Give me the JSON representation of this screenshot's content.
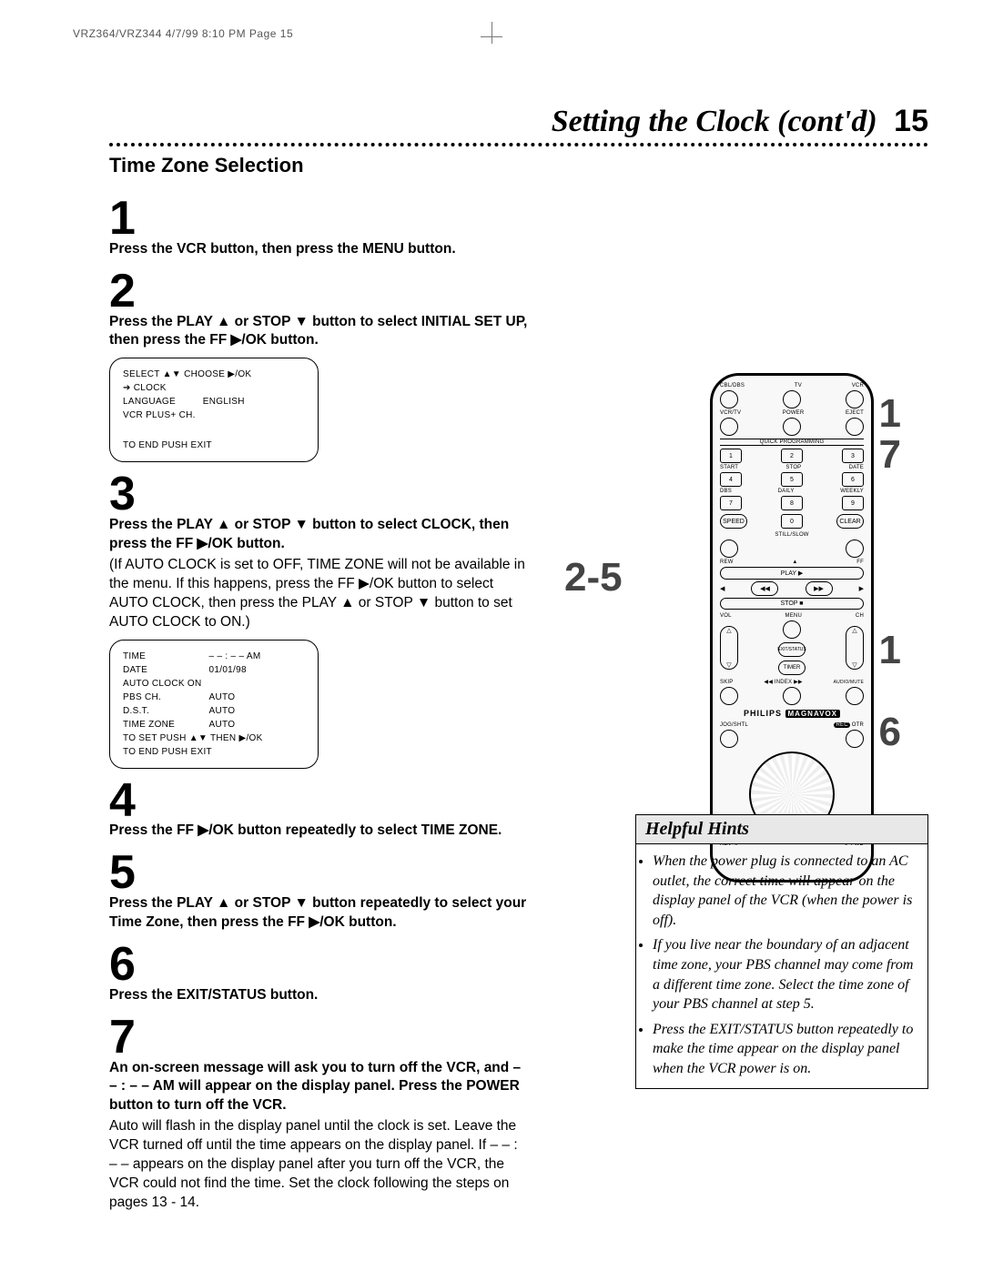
{
  "header_note": "VRZ364/VRZ344  4/7/99 8:10 PM  Page 15",
  "title": "Setting the Clock (cont'd)",
  "page_number": "15",
  "section": "Time Zone Selection",
  "steps": [
    {
      "n": "1",
      "head": "Press the VCR button, then press the MENU button."
    },
    {
      "n": "2",
      "head": "Press the PLAY ▲ or STOP ▼ button to select INITIAL SET UP, then press the FF ▶/OK button."
    },
    {
      "n": "3",
      "head": "Press the PLAY ▲ or STOP ▼ button to select CLOCK, then press the FF ▶/OK button.",
      "body": "(If AUTO CLOCK is set to OFF, TIME ZONE will not be available in the menu. If this happens, press the FF ▶/OK button to select AUTO CLOCK, then press the PLAY ▲ or STOP ▼ button to set AUTO CLOCK to ON.)"
    },
    {
      "n": "4",
      "head": "Press the FF ▶/OK button repeatedly to select TIME ZONE."
    },
    {
      "n": "5",
      "head": "Press the PLAY ▲ or STOP ▼ button repeatedly to select your Time Zone, then press the FF ▶/OK button."
    },
    {
      "n": "6",
      "head": "Press the EXIT/STATUS button."
    },
    {
      "n": "7",
      "head": "An on-screen message will ask you to turn off the VCR, and – – : – – AM will appear on the display panel. Press the POWER button to turn off the VCR.",
      "body": "Auto will flash in the display panel until the clock is set. Leave the VCR turned off until the time appears on the display panel. If – – : – – appears on the display panel after you turn off the VCR, the VCR could not find the time. Set the clock following the steps on pages 13 - 14."
    }
  ],
  "osd1": {
    "top": "SELECT ▲▼      CHOOSE ▶/OK",
    "rows": [
      [
        "➔ CLOCK",
        ""
      ],
      [
        "   LANGUAGE",
        "ENGLISH"
      ],
      [
        "   VCR PLUS+ CH.",
        ""
      ]
    ],
    "bottom": "TO END PUSH EXIT"
  },
  "osd2": {
    "rows": [
      [
        "TIME",
        "– – : – – AM"
      ],
      [
        "DATE",
        "01/01/98"
      ],
      [
        "",
        ""
      ],
      [
        "AUTO CLOCK  ON",
        ""
      ],
      [
        "PBS CH.",
        "AUTO"
      ],
      [
        "D.S.T.",
        "AUTO"
      ],
      [
        "TIME ZONE",
        "AUTO"
      ]
    ],
    "line1": "TO SET PUSH ▲▼ THEN ▶/OK",
    "line2": "TO END PUSH EXIT"
  },
  "remote": {
    "row1": [
      "CBL/DBS",
      "TV",
      "VCR"
    ],
    "row2": [
      "VCR/TV",
      "POWER",
      "EJECT"
    ],
    "quick": "QUICK PROGRAMMING",
    "keypad": [
      [
        "1",
        "2",
        "3"
      ],
      [
        "4",
        "5",
        "6"
      ],
      [
        "7",
        "8",
        "9"
      ]
    ],
    "klabels1": [
      "START",
      "STOP",
      "DATE"
    ],
    "klabels2": [
      "DBS",
      "DAILY",
      "WEEKLY"
    ],
    "speed": "SPEED",
    "zero": "0",
    "clear": "CLEAR",
    "still": "STILL/SLOW",
    "minus": "–",
    "plus": "+",
    "rew": "REW",
    "play": "PLAY ▶",
    "ff": "FF",
    "stop": "STOP ■",
    "vol": "VOL",
    "menu": "MENU",
    "ch": "CH",
    "exit": "EXIT/STATUS",
    "timer": "TIMER",
    "skip": "SKIP",
    "index": "◀◀ INDEX ▶▶",
    "audio": "AUDIO/MUTE",
    "brand1": "PHILIPS",
    "brand2": "MAGNAVOX",
    "jog": "JOG/SHTL",
    "rec": "REC",
    "otr": "OTR",
    "revj": "REV ⟲",
    "fwdj": "⟳ FWD"
  },
  "callouts": {
    "a": "1",
    "b": "7",
    "c": "2-5",
    "d": "1",
    "e": "6"
  },
  "hints": {
    "title": "Helpful Hints",
    "items": [
      "When the power plug is connected to an AC outlet, the correct time will appear on the display panel of the VCR (when the power is off).",
      "If you live near the boundary of an adjacent time zone, your PBS channel may come from a different time zone. Select the time zone of your PBS channel at step 5.",
      "Press the EXIT/STATUS button repeatedly to make the time appear on the display panel when the VCR power is on."
    ]
  }
}
